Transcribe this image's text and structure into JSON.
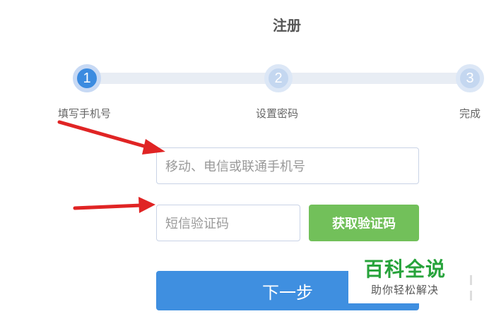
{
  "page": {
    "title": "注册"
  },
  "steps": [
    {
      "number": "1",
      "label": "填写手机号",
      "state": "active"
    },
    {
      "number": "2",
      "label": "设置密码",
      "state": "inactive"
    },
    {
      "number": "3",
      "label": "完成",
      "state": "inactive"
    }
  ],
  "form": {
    "phone_placeholder": "移动、电信或联通手机号",
    "code_placeholder": "短信验证码",
    "get_code_label": "获取验证码",
    "next_label": "下一步"
  },
  "watermark": {
    "title": "百科全说",
    "subtitle": "助你轻松解决"
  },
  "colors": {
    "primary": "#3f8fe0",
    "get_code_button": "#72c05a",
    "arrow": "#e02424",
    "watermark_green": "#27a33b"
  }
}
